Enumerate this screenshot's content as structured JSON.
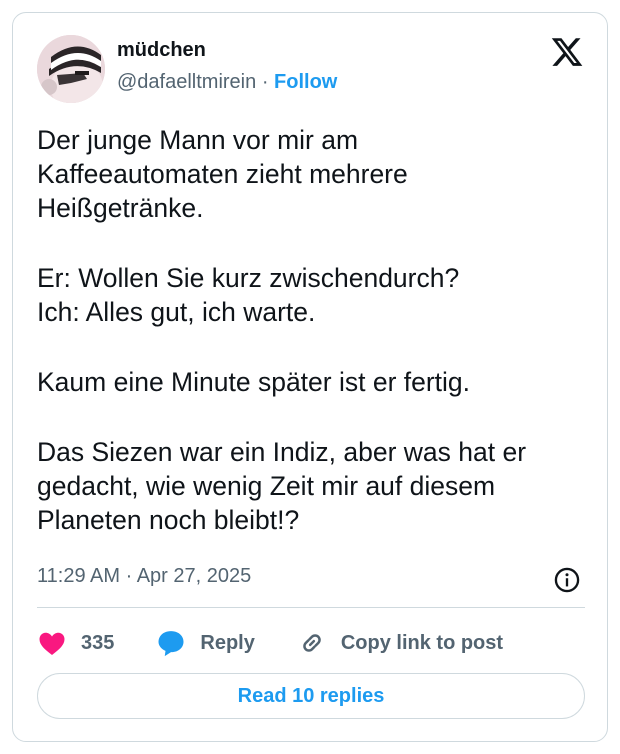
{
  "author": {
    "display_name": "müdchen",
    "handle": "@dafaelltmirein",
    "separator": "·",
    "follow_label": "Follow"
  },
  "tweet": {
    "paragraphs": [
      "Der junge Mann vor mir am\nKaffeeautomaten zieht mehrere\nHeißgetränke.",
      "Er: Wollen Sie kurz zwischendurch?\nIch: Alles gut, ich warte.",
      "Kaum eine Minute später ist er fertig.",
      "Das Siezen war ein Indiz, aber was hat er\ngedacht, wie wenig Zeit mir auf diesem\nPlaneten noch bleibt!?"
    ],
    "timestamp": "11:29 AM · Apr 27, 2025"
  },
  "actions": {
    "like_count": "335",
    "reply_label": "Reply",
    "copy_label": "Copy link to post"
  },
  "read_replies_label": "Read 10 replies",
  "colors": {
    "accent": "#1d9bf0",
    "like": "#f91880",
    "text": "#0f1419",
    "muted": "#536471",
    "border": "#cfd9de"
  },
  "icons": [
    "x-logo-icon",
    "info-icon",
    "heart-icon",
    "reply-bubble-icon",
    "link-icon"
  ]
}
